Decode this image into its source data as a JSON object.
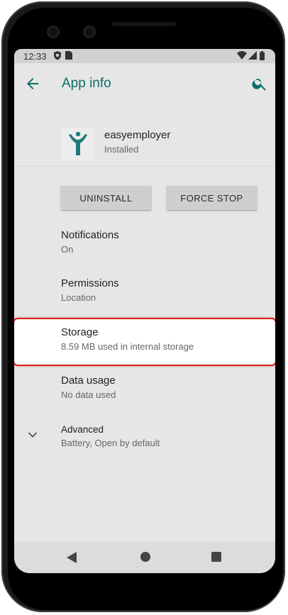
{
  "status_bar": {
    "time": "12:33",
    "icons": [
      "shield-icon",
      "sim-card-icon",
      "wifi-icon",
      "signal-icon",
      "battery-icon"
    ]
  },
  "app_bar": {
    "title": "App info",
    "back_icon": "arrow-left-icon",
    "search_icon": "search-icon"
  },
  "app": {
    "name": "easyemployer",
    "status": "Installed",
    "icon": "easyemployer-logo-icon",
    "accent_color": "#1f7a7a"
  },
  "buttons": {
    "uninstall": "UNINSTALL",
    "force_stop": "FORCE STOP"
  },
  "items": [
    {
      "title": "Notifications",
      "subtitle": "On"
    },
    {
      "title": "Permissions",
      "subtitle": "Location"
    },
    {
      "title": "Storage",
      "subtitle": "8.59 MB used in internal storage",
      "highlighted": true
    },
    {
      "title": "Data usage",
      "subtitle": "No data used"
    },
    {
      "title": "Advanced",
      "subtitle": "Battery, Open by default",
      "icon": "chevron-down-icon"
    }
  ],
  "nav_bar": {
    "back": "back-triangle-icon",
    "home": "home-circle-icon",
    "recents": "recents-square-icon"
  },
  "colors": {
    "title_teal": "#0f6e66",
    "highlight_border": "#d61f1f"
  }
}
